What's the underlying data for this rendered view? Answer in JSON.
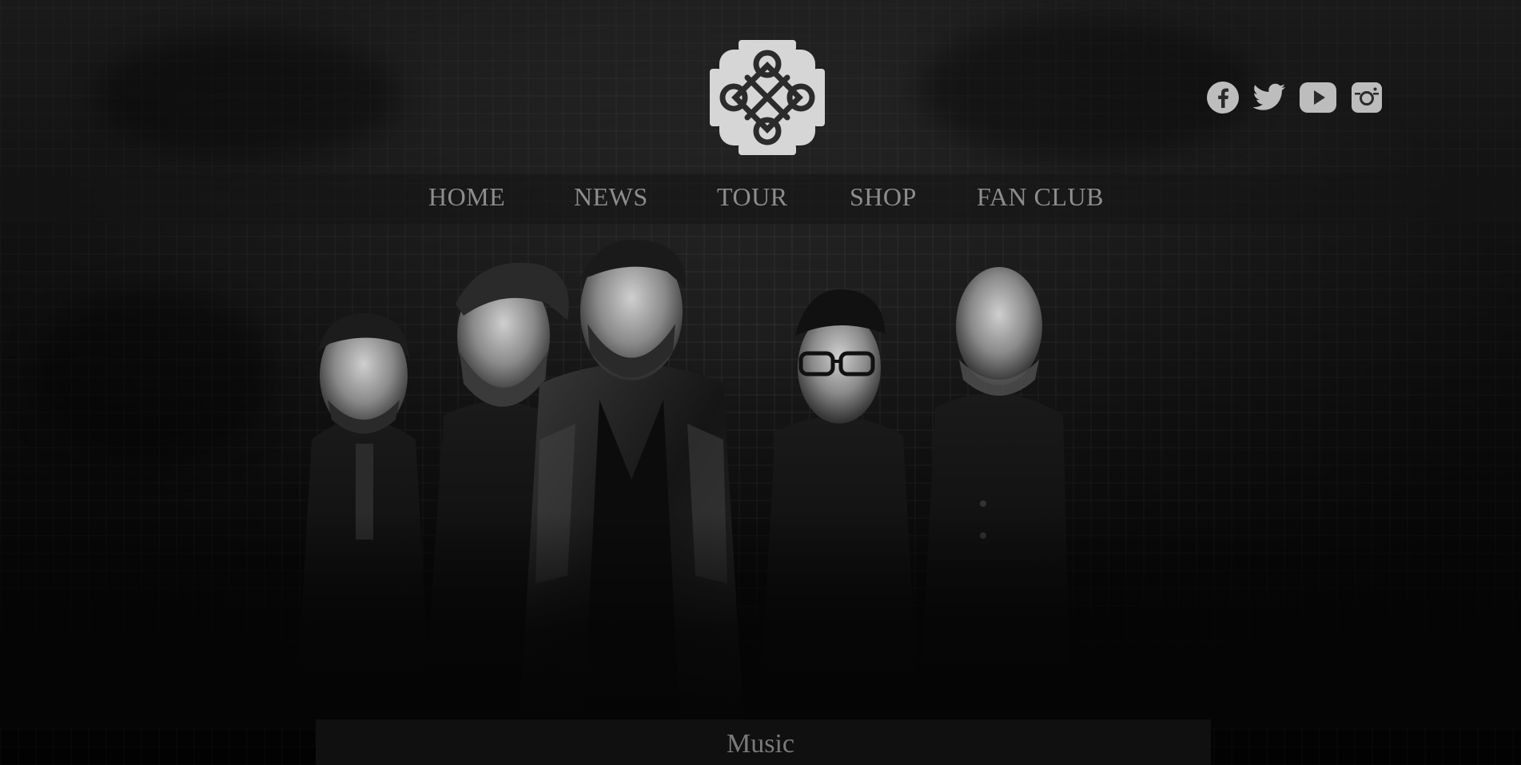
{
  "brand": {
    "logo_icon": "celtic-knot-icon"
  },
  "social": [
    {
      "icon": "facebook-icon"
    },
    {
      "icon": "twitter-icon"
    },
    {
      "icon": "youtube-icon"
    },
    {
      "icon": "instagram-icon"
    }
  ],
  "nav": {
    "items": [
      {
        "label": "HOME"
      },
      {
        "label": "NEWS"
      },
      {
        "label": "TOUR"
      },
      {
        "label": "SHOP"
      },
      {
        "label": "FAN CLUB"
      }
    ]
  },
  "hero": {
    "image": "band-photo"
  },
  "section": {
    "title": "Music"
  },
  "colors": {
    "nav_text": "#8d8d8d",
    "icon": "#bdbdbd",
    "logo": "#d6d6d6"
  }
}
